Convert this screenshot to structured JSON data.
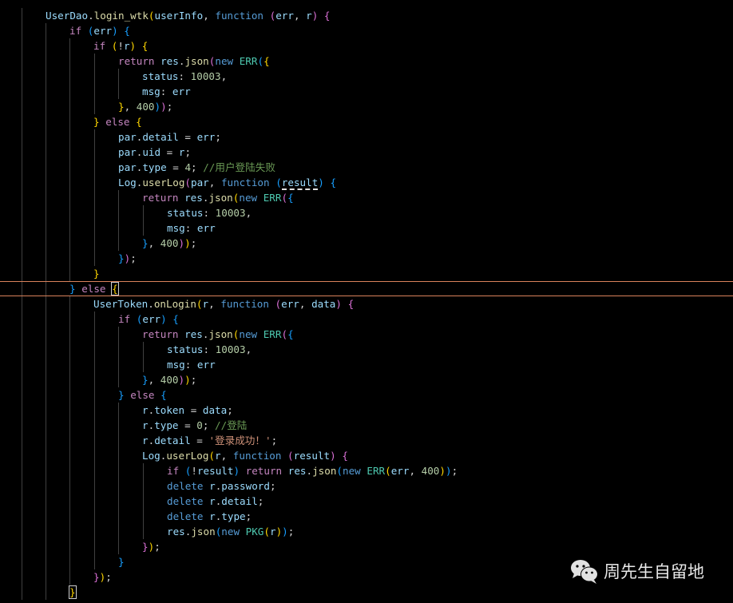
{
  "editor": {
    "theme_colors": {
      "background": "#000000",
      "keyword": "#c586c0",
      "storage": "#569cd6",
      "function": "#dcdcaa",
      "variable": "#9cdcfe",
      "class": "#4ec9b0",
      "number": "#b5cea8",
      "string": "#ce9178",
      "comment": "#6a9955",
      "current_line_border": "#d9825b"
    },
    "lines": [
      {
        "indent": 1,
        "tokens": [
          [
            "var",
            "UserDao"
          ],
          [
            "pl",
            "."
          ],
          [
            "fn",
            "login_wtk"
          ],
          [
            "b1",
            "("
          ],
          [
            "var",
            "userInfo"
          ],
          [
            "pl",
            ", "
          ],
          [
            "st",
            "function"
          ],
          [
            "pl",
            " "
          ],
          [
            "b2",
            "("
          ],
          [
            "var",
            "err"
          ],
          [
            "pl",
            ", "
          ],
          [
            "var",
            "r"
          ],
          [
            "b2",
            ")"
          ],
          [
            "pl",
            " "
          ],
          [
            "b2",
            "{"
          ]
        ]
      },
      {
        "indent": 2,
        "tokens": [
          [
            "kw",
            "if"
          ],
          [
            "pl",
            " "
          ],
          [
            "b3",
            "("
          ],
          [
            "var",
            "err"
          ],
          [
            "b3",
            ")"
          ],
          [
            "pl",
            " "
          ],
          [
            "b3",
            "{"
          ]
        ]
      },
      {
        "indent": 3,
        "tokens": [
          [
            "kw",
            "if"
          ],
          [
            "pl",
            " "
          ],
          [
            "b1",
            "("
          ],
          [
            "pl",
            "!"
          ],
          [
            "var",
            "r"
          ],
          [
            "b1",
            ")"
          ],
          [
            "pl",
            " "
          ],
          [
            "b1",
            "{"
          ]
        ]
      },
      {
        "indent": 4,
        "tokens": [
          [
            "kw",
            "return"
          ],
          [
            "pl",
            " "
          ],
          [
            "var",
            "res"
          ],
          [
            "pl",
            "."
          ],
          [
            "fn",
            "json"
          ],
          [
            "b2",
            "("
          ],
          [
            "st",
            "new"
          ],
          [
            "pl",
            " "
          ],
          [
            "cls",
            "ERR"
          ],
          [
            "b3",
            "("
          ],
          [
            "b1",
            "{"
          ]
        ]
      },
      {
        "indent": 5,
        "tokens": [
          [
            "var",
            "status"
          ],
          [
            "pl",
            ": "
          ],
          [
            "num",
            "10003"
          ],
          [
            "pl",
            ","
          ]
        ]
      },
      {
        "indent": 5,
        "tokens": [
          [
            "var",
            "msg"
          ],
          [
            "pl",
            ": "
          ],
          [
            "var",
            "err"
          ]
        ]
      },
      {
        "indent": 4,
        "tokens": [
          [
            "b1",
            "}"
          ],
          [
            "pl",
            ", "
          ],
          [
            "num",
            "400"
          ],
          [
            "b3",
            ")"
          ],
          [
            "b2",
            ")"
          ],
          [
            "pl",
            ";"
          ]
        ]
      },
      {
        "indent": 3,
        "tokens": [
          [
            "b1",
            "}"
          ],
          [
            "pl",
            " "
          ],
          [
            "kw",
            "else"
          ],
          [
            "pl",
            " "
          ],
          [
            "b1",
            "{"
          ]
        ]
      },
      {
        "indent": 4,
        "tokens": [
          [
            "var",
            "par"
          ],
          [
            "pl",
            "."
          ],
          [
            "var",
            "detail"
          ],
          [
            "pl",
            " = "
          ],
          [
            "var",
            "err"
          ],
          [
            "pl",
            ";"
          ]
        ]
      },
      {
        "indent": 4,
        "tokens": [
          [
            "var",
            "par"
          ],
          [
            "pl",
            "."
          ],
          [
            "var",
            "uid"
          ],
          [
            "pl",
            " = "
          ],
          [
            "var",
            "r"
          ],
          [
            "pl",
            ";"
          ]
        ]
      },
      {
        "indent": 4,
        "tokens": [
          [
            "var",
            "par"
          ],
          [
            "pl",
            "."
          ],
          [
            "var",
            "type"
          ],
          [
            "pl",
            " = "
          ],
          [
            "num",
            "4"
          ],
          [
            "pl",
            "; "
          ],
          [
            "cm",
            "//用户登陆失败"
          ]
        ]
      },
      {
        "indent": 4,
        "tokens": [
          [
            "var",
            "Log"
          ],
          [
            "pl",
            "."
          ],
          [
            "fn",
            "userLog"
          ],
          [
            "b2",
            "("
          ],
          [
            "var",
            "par"
          ],
          [
            "pl",
            ", "
          ],
          [
            "st",
            "function"
          ],
          [
            "pl",
            " "
          ],
          [
            "b3",
            "("
          ],
          [
            "sq",
            "result"
          ],
          [
            "b3",
            ")"
          ],
          [
            "pl",
            " "
          ],
          [
            "b3",
            "{"
          ]
        ]
      },
      {
        "indent": 5,
        "tokens": [
          [
            "kw",
            "return"
          ],
          [
            "pl",
            " "
          ],
          [
            "var",
            "res"
          ],
          [
            "pl",
            "."
          ],
          [
            "fn",
            "json"
          ],
          [
            "b1",
            "("
          ],
          [
            "st",
            "new"
          ],
          [
            "pl",
            " "
          ],
          [
            "cls",
            "ERR"
          ],
          [
            "b2",
            "("
          ],
          [
            "b3",
            "{"
          ]
        ]
      },
      {
        "indent": 6,
        "tokens": [
          [
            "var",
            "status"
          ],
          [
            "pl",
            ": "
          ],
          [
            "num",
            "10003"
          ],
          [
            "pl",
            ","
          ]
        ]
      },
      {
        "indent": 6,
        "tokens": [
          [
            "var",
            "msg"
          ],
          [
            "pl",
            ": "
          ],
          [
            "var",
            "err"
          ]
        ]
      },
      {
        "indent": 5,
        "tokens": [
          [
            "b3",
            "}"
          ],
          [
            "pl",
            ", "
          ],
          [
            "num",
            "400"
          ],
          [
            "b2",
            ")"
          ],
          [
            "b1",
            ")"
          ],
          [
            "pl",
            ";"
          ]
        ]
      },
      {
        "indent": 4,
        "tokens": [
          [
            "b3",
            "}"
          ],
          [
            "b2",
            ")"
          ],
          [
            "pl",
            ";"
          ]
        ]
      },
      {
        "indent": 3,
        "tokens": [
          [
            "b1",
            "}"
          ]
        ]
      },
      {
        "indent": 2,
        "current": true,
        "tokens": [
          [
            "b3",
            "}"
          ],
          [
            "pl",
            " "
          ],
          [
            "kw",
            "else"
          ],
          [
            "pl",
            " "
          ],
          [
            "cur",
            "{"
          ]
        ]
      },
      {
        "indent": 3,
        "tokens": [
          [
            "var",
            "UserToken"
          ],
          [
            "pl",
            "."
          ],
          [
            "fn",
            "onLogin"
          ],
          [
            "b1",
            "("
          ],
          [
            "var",
            "r"
          ],
          [
            "pl",
            ", "
          ],
          [
            "st",
            "function"
          ],
          [
            "pl",
            " "
          ],
          [
            "b2",
            "("
          ],
          [
            "var",
            "err"
          ],
          [
            "pl",
            ", "
          ],
          [
            "var",
            "data"
          ],
          [
            "b2",
            ")"
          ],
          [
            "pl",
            " "
          ],
          [
            "b2",
            "{"
          ]
        ]
      },
      {
        "indent": 4,
        "tokens": [
          [
            "kw",
            "if"
          ],
          [
            "pl",
            " "
          ],
          [
            "b3",
            "("
          ],
          [
            "var",
            "err"
          ],
          [
            "b3",
            ")"
          ],
          [
            "pl",
            " "
          ],
          [
            "b3",
            "{"
          ]
        ]
      },
      {
        "indent": 5,
        "tokens": [
          [
            "kw",
            "return"
          ],
          [
            "pl",
            " "
          ],
          [
            "var",
            "res"
          ],
          [
            "pl",
            "."
          ],
          [
            "fn",
            "json"
          ],
          [
            "b1",
            "("
          ],
          [
            "st",
            "new"
          ],
          [
            "pl",
            " "
          ],
          [
            "cls",
            "ERR"
          ],
          [
            "b2",
            "("
          ],
          [
            "b3",
            "{"
          ]
        ]
      },
      {
        "indent": 6,
        "tokens": [
          [
            "var",
            "status"
          ],
          [
            "pl",
            ": "
          ],
          [
            "num",
            "10003"
          ],
          [
            "pl",
            ","
          ]
        ]
      },
      {
        "indent": 6,
        "tokens": [
          [
            "var",
            "msg"
          ],
          [
            "pl",
            ": "
          ],
          [
            "var",
            "err"
          ]
        ]
      },
      {
        "indent": 5,
        "tokens": [
          [
            "b3",
            "}"
          ],
          [
            "pl",
            ", "
          ],
          [
            "num",
            "400"
          ],
          [
            "b2",
            ")"
          ],
          [
            "b1",
            ")"
          ],
          [
            "pl",
            ";"
          ]
        ]
      },
      {
        "indent": 4,
        "tokens": [
          [
            "b3",
            "}"
          ],
          [
            "pl",
            " "
          ],
          [
            "kw",
            "else"
          ],
          [
            "pl",
            " "
          ],
          [
            "b3",
            "{"
          ]
        ]
      },
      {
        "indent": 5,
        "tokens": [
          [
            "var",
            "r"
          ],
          [
            "pl",
            "."
          ],
          [
            "var",
            "token"
          ],
          [
            "pl",
            " = "
          ],
          [
            "var",
            "data"
          ],
          [
            "pl",
            ";"
          ]
        ]
      },
      {
        "indent": 5,
        "tokens": [
          [
            "var",
            "r"
          ],
          [
            "pl",
            "."
          ],
          [
            "var",
            "type"
          ],
          [
            "pl",
            " = "
          ],
          [
            "num",
            "0"
          ],
          [
            "pl",
            "; "
          ],
          [
            "cm",
            "//登陆"
          ]
        ]
      },
      {
        "indent": 5,
        "tokens": [
          [
            "var",
            "r"
          ],
          [
            "pl",
            "."
          ],
          [
            "var",
            "detail"
          ],
          [
            "pl",
            " = "
          ],
          [
            "str",
            "'登录成功！'"
          ],
          [
            "pl",
            ";"
          ]
        ]
      },
      {
        "indent": 5,
        "tokens": [
          [
            "var",
            "Log"
          ],
          [
            "pl",
            "."
          ],
          [
            "fn",
            "userLog"
          ],
          [
            "b1",
            "("
          ],
          [
            "var",
            "r"
          ],
          [
            "pl",
            ", "
          ],
          [
            "st",
            "function"
          ],
          [
            "pl",
            " "
          ],
          [
            "b2",
            "("
          ],
          [
            "var",
            "result"
          ],
          [
            "b2",
            ")"
          ],
          [
            "pl",
            " "
          ],
          [
            "b2",
            "{"
          ]
        ]
      },
      {
        "indent": 6,
        "tokens": [
          [
            "kw",
            "if"
          ],
          [
            "pl",
            " "
          ],
          [
            "b3",
            "("
          ],
          [
            "pl",
            "!"
          ],
          [
            "var",
            "result"
          ],
          [
            "b3",
            ")"
          ],
          [
            "pl",
            " "
          ],
          [
            "kw",
            "return"
          ],
          [
            "pl",
            " "
          ],
          [
            "var",
            "res"
          ],
          [
            "pl",
            "."
          ],
          [
            "fn",
            "json"
          ],
          [
            "b3",
            "("
          ],
          [
            "st",
            "new"
          ],
          [
            "pl",
            " "
          ],
          [
            "cls",
            "ERR"
          ],
          [
            "b1",
            "("
          ],
          [
            "var",
            "err"
          ],
          [
            "pl",
            ", "
          ],
          [
            "num",
            "400"
          ],
          [
            "b1",
            ")"
          ],
          [
            "b3",
            ")"
          ],
          [
            "pl",
            ";"
          ]
        ]
      },
      {
        "indent": 6,
        "tokens": [
          [
            "st",
            "delete"
          ],
          [
            "pl",
            " "
          ],
          [
            "var",
            "r"
          ],
          [
            "pl",
            "."
          ],
          [
            "var",
            "password"
          ],
          [
            "pl",
            ";"
          ]
        ]
      },
      {
        "indent": 6,
        "tokens": [
          [
            "st",
            "delete"
          ],
          [
            "pl",
            " "
          ],
          [
            "var",
            "r"
          ],
          [
            "pl",
            "."
          ],
          [
            "var",
            "detail"
          ],
          [
            "pl",
            ";"
          ]
        ]
      },
      {
        "indent": 6,
        "tokens": [
          [
            "st",
            "delete"
          ],
          [
            "pl",
            " "
          ],
          [
            "var",
            "r"
          ],
          [
            "pl",
            "."
          ],
          [
            "var",
            "type"
          ],
          [
            "pl",
            ";"
          ]
        ]
      },
      {
        "indent": 6,
        "tokens": [
          [
            "var",
            "res"
          ],
          [
            "pl",
            "."
          ],
          [
            "fn",
            "json"
          ],
          [
            "b3",
            "("
          ],
          [
            "st",
            "new"
          ],
          [
            "pl",
            " "
          ],
          [
            "cls",
            "PKG"
          ],
          [
            "b1",
            "("
          ],
          [
            "var",
            "r"
          ],
          [
            "b1",
            ")"
          ],
          [
            "b3",
            ")"
          ],
          [
            "pl",
            ";"
          ]
        ]
      },
      {
        "indent": 5,
        "tokens": [
          [
            "b2",
            "}"
          ],
          [
            "b1",
            ")"
          ],
          [
            "pl",
            ";"
          ]
        ]
      },
      {
        "indent": 4,
        "tokens": [
          [
            "b3",
            "}"
          ]
        ]
      },
      {
        "indent": 3,
        "tokens": [
          [
            "b2",
            "}"
          ],
          [
            "b1",
            ")"
          ],
          [
            "pl",
            ";"
          ]
        ]
      },
      {
        "indent": 2,
        "tokens": [
          [
            "cur3",
            "}"
          ]
        ]
      }
    ]
  },
  "watermark": {
    "icon": "wechat-icon",
    "text": "周先生自留地"
  }
}
